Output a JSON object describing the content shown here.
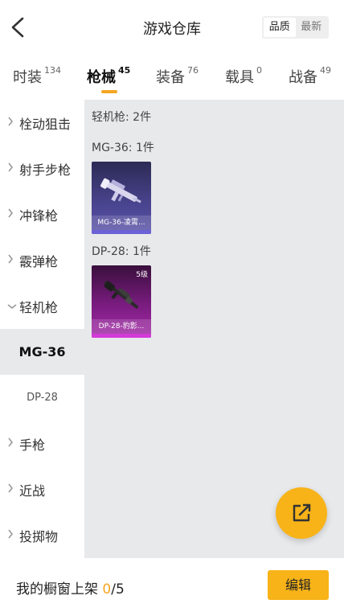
{
  "header": {
    "title": "游戏仓库",
    "sort_options": [
      "品质",
      "最新"
    ]
  },
  "tabs": [
    {
      "label": "时装",
      "count": "134"
    },
    {
      "label": "枪械",
      "count": "45"
    },
    {
      "label": "装备",
      "count": "76"
    },
    {
      "label": "载具",
      "count": "0"
    },
    {
      "label": "战备",
      "count": "49"
    }
  ],
  "sidebar": {
    "categories": [
      "栓动狙击",
      "射手步枪",
      "冲锋枪",
      "霰弹枪",
      "轻机枪",
      "MG-36",
      "DP-28",
      "手枪",
      "近战",
      "投掷物"
    ]
  },
  "content": {
    "category_count": "轻机枪: 2件",
    "groups": [
      {
        "heading": "MG-36: 1件",
        "item_name": "MG-36-凌霄...",
        "level": ""
      },
      {
        "heading": "DP-28: 1件",
        "item_name": "DP-28-豹影...",
        "level": "5级"
      }
    ]
  },
  "footer": {
    "shelf_prefix": "我的橱窗上架",
    "shelf_current": "0",
    "shelf_total": "/5",
    "edit_label": "编辑"
  },
  "colors": {
    "accent": "#f7b318",
    "content_bg": "#e8e9eb",
    "epic_purple": "#5a52a8",
    "legendary_pink": "#a52aa9"
  },
  "icons": [
    "back-arrow-icon",
    "chevron-right-icon",
    "chevron-down-icon",
    "share-icon"
  ]
}
